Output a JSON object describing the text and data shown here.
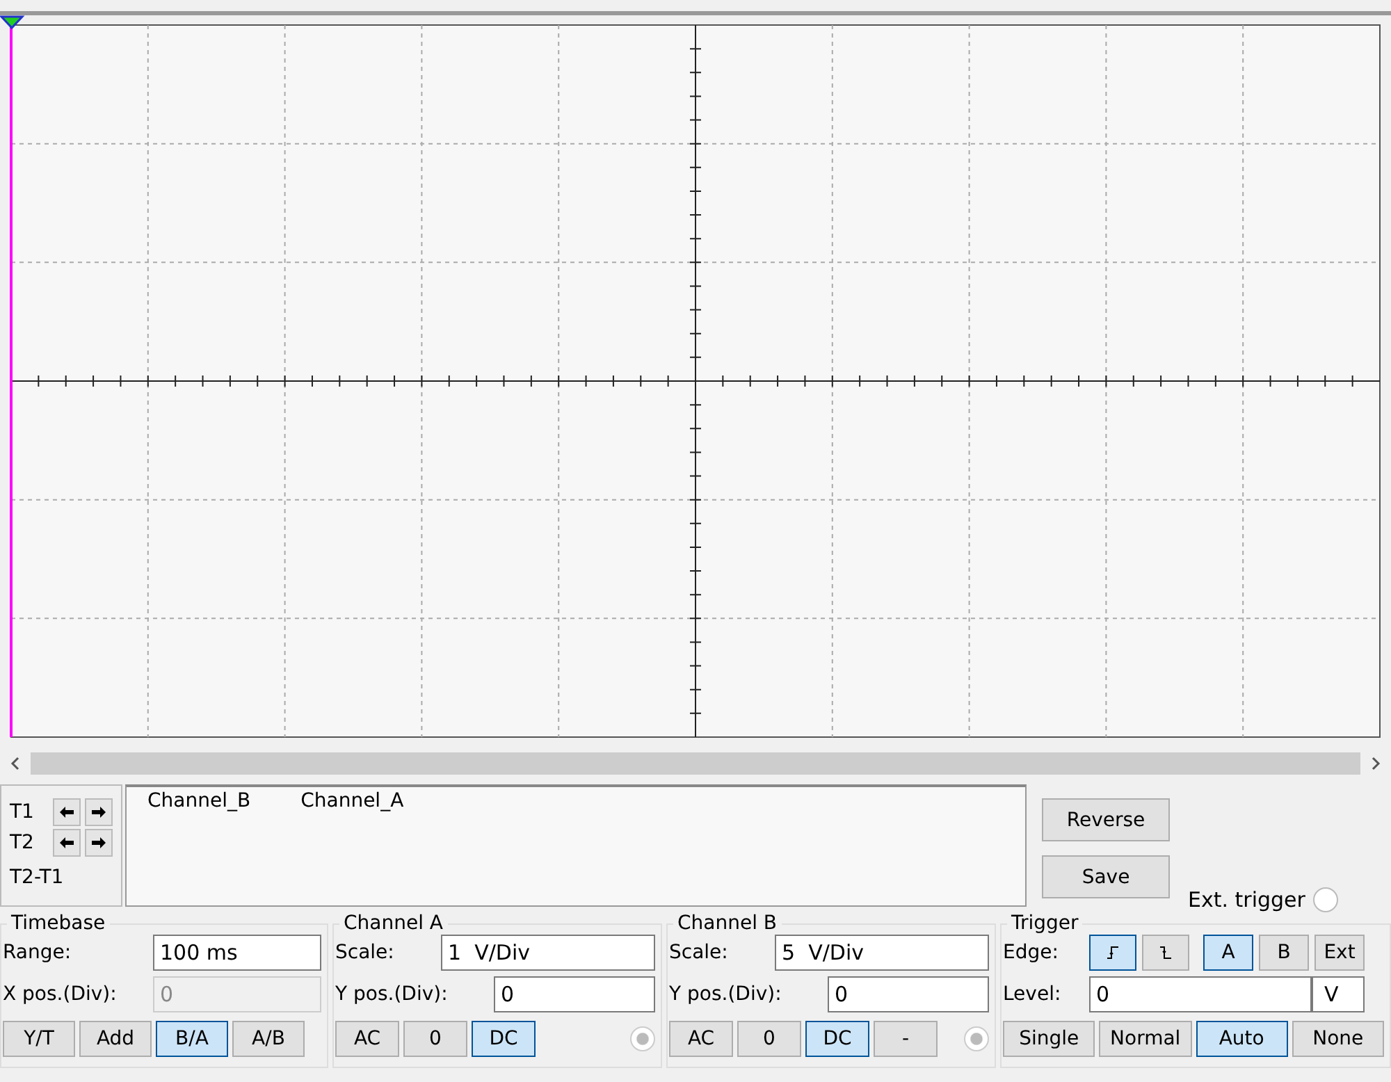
{
  "cursors": [
    {
      "label": "T1"
    },
    {
      "label": "T2"
    }
  ],
  "cursor_diff": "T2-T1",
  "legend": [
    "Channel_B",
    "Channel_A"
  ],
  "actions": [
    "Reverse",
    "Save"
  ],
  "ext_trigger": {
    "label": "Ext. trigger",
    "checked": false
  },
  "timebase": {
    "title": "Timebase",
    "range_label": "Range:",
    "range": "100 ms",
    "xpos_label": "X pos.(Div):",
    "xpos": "0",
    "xpos_disabled": true,
    "modes": [
      {
        "label": "Y/T",
        "selected": false
      },
      {
        "label": "Add",
        "selected": false
      },
      {
        "label": "B/A",
        "selected": true
      },
      {
        "label": "A/B",
        "selected": false
      }
    ]
  },
  "channels": [
    {
      "title": "Channel A",
      "scale_label": "Scale:",
      "scale": "1  V/Div",
      "ypos_label": "Y pos.(Div):",
      "ypos": "0",
      "coupling": [
        {
          "label": "AC",
          "selected": false
        },
        {
          "label": "0",
          "selected": false
        },
        {
          "label": "DC",
          "selected": true
        }
      ]
    },
    {
      "title": "Channel B",
      "scale_label": "Scale:",
      "scale": "5  V/Div",
      "ypos_label": "Y pos.(Div):",
      "ypos": "0",
      "coupling": [
        {
          "label": "AC",
          "selected": false
        },
        {
          "label": "0",
          "selected": false
        },
        {
          "label": "DC",
          "selected": true
        },
        {
          "label": "-",
          "selected": false
        }
      ]
    }
  ],
  "trigger": {
    "title": "Trigger",
    "edge_label": "Edge:",
    "edges": [
      {
        "kind": "rising",
        "selected": true
      },
      {
        "kind": "falling",
        "selected": false
      }
    ],
    "sources": [
      {
        "label": "A",
        "selected": true
      },
      {
        "label": "B",
        "selected": false
      },
      {
        "label": "Ext",
        "selected": false
      }
    ],
    "level_label": "Level:",
    "level": "0",
    "unit": "V",
    "modes": [
      {
        "label": "Single",
        "selected": false
      },
      {
        "label": "Normal",
        "selected": false
      },
      {
        "label": "Auto",
        "selected": true
      },
      {
        "label": "None",
        "selected": false
      }
    ]
  }
}
